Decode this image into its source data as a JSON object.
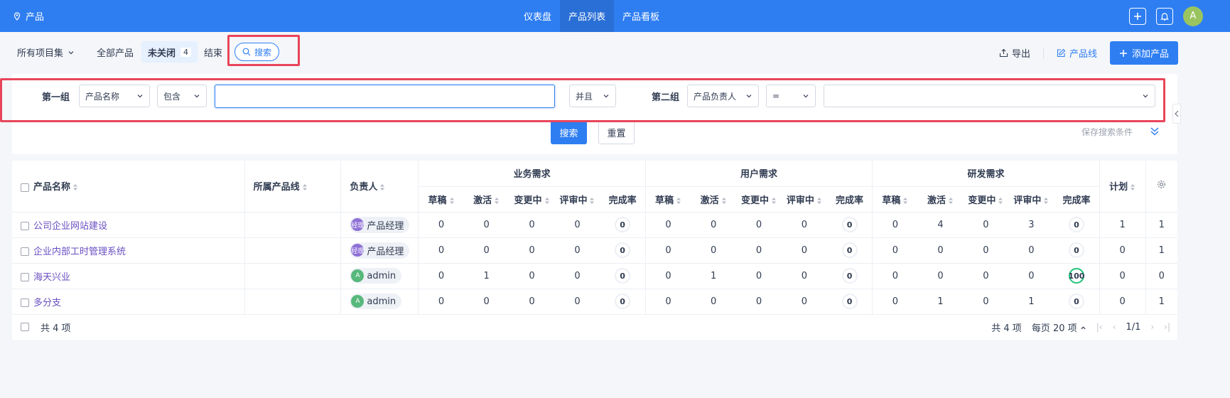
{
  "header": {
    "brand": "产品",
    "nav": [
      {
        "label": "仪表盘",
        "active": false
      },
      {
        "label": "产品列表",
        "active": true
      },
      {
        "label": "产品看板",
        "active": false
      }
    ],
    "avatar_letter": "A",
    "accent_color": "#2e7ef2"
  },
  "subbar": {
    "project_select": "所有项目集",
    "tabs": [
      {
        "label": "全部产品",
        "active": false
      },
      {
        "label": "未关闭",
        "active": true,
        "count": "4"
      },
      {
        "label": "结束",
        "active": false
      }
    ],
    "search_tab": "搜索",
    "export": "导出",
    "product_line": "产品线",
    "add_product": "添加产品"
  },
  "search_form": {
    "group1_label": "第一组",
    "group1_field": "产品名称",
    "group1_operator": "包含",
    "group1_value": "",
    "conjunction": "并且",
    "group2_label": "第二组",
    "group2_field": "产品负责人",
    "group2_operator": "=",
    "group2_value": "",
    "search_button": "搜索",
    "reset_button": "重置",
    "save_conditions": "保存搜索条件"
  },
  "table": {
    "headers": {
      "name": "产品名称",
      "line": "所属产品线",
      "owner": "负责人",
      "group_biz": "业务需求",
      "group_user": "用户需求",
      "group_dev": "研发需求",
      "plan": "计划",
      "sub": [
        "草稿",
        "激活",
        "变更中",
        "评审中",
        "完成率"
      ]
    },
    "rows": [
      {
        "name": "公司企业网站建设",
        "line": "",
        "owner": "产品经理",
        "owner_avatar": "经理",
        "owner_color": "#8e6fd6",
        "biz": [
          "0",
          "0",
          "0",
          "0",
          "0"
        ],
        "user": [
          "0",
          "0",
          "0",
          "0",
          "0"
        ],
        "dev": [
          "0",
          "4",
          "0",
          "3",
          "0"
        ],
        "plan": "1",
        "last": "1"
      },
      {
        "name": "企业内部工时管理系统",
        "line": "",
        "owner": "产品经理",
        "owner_avatar": "经理",
        "owner_color": "#8e6fd6",
        "biz": [
          "0",
          "0",
          "0",
          "0",
          "0"
        ],
        "user": [
          "0",
          "0",
          "0",
          "0",
          "0"
        ],
        "dev": [
          "0",
          "0",
          "0",
          "0",
          "0"
        ],
        "plan": "0",
        "last": "1"
      },
      {
        "name": "海天兴业",
        "line": "",
        "owner": "admin",
        "owner_avatar": "A",
        "owner_color": "#57b87b",
        "biz": [
          "0",
          "1",
          "0",
          "0",
          "0"
        ],
        "user": [
          "0",
          "1",
          "0",
          "0",
          "0"
        ],
        "dev": [
          "0",
          "0",
          "0",
          "0",
          "100"
        ],
        "plan": "0",
        "last": "0"
      },
      {
        "name": "多分支",
        "line": "",
        "owner": "admin",
        "owner_avatar": "A",
        "owner_color": "#57b87b",
        "biz": [
          "0",
          "0",
          "0",
          "0",
          "0"
        ],
        "user": [
          "0",
          "0",
          "0",
          "0",
          "0"
        ],
        "dev": [
          "0",
          "1",
          "0",
          "1",
          "0"
        ],
        "plan": "0",
        "last": "1"
      }
    ],
    "footer_total": "共 4 项",
    "pager_total": "共 4 项",
    "per_page": "每页 20 项",
    "page": "1/1"
  }
}
